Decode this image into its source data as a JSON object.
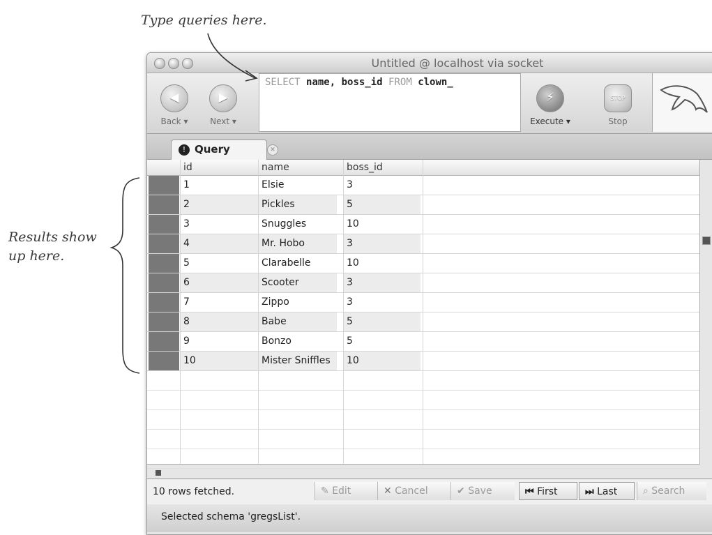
{
  "annotations": {
    "type_queries": "Type queries here.",
    "results_show": "Results show up here."
  },
  "window": {
    "title": "Untitled @ localhost via socket"
  },
  "toolbar": {
    "back_label": "Back ▾",
    "next_label": "Next ▾",
    "execute_label": "Execute ▾",
    "stop_label": "Stop",
    "stop_glyph": "STOP"
  },
  "query": {
    "select_kw": "SELECT",
    "fields": "name, boss_id",
    "from_kw": "FROM",
    "table": "clown_"
  },
  "tabs": [
    {
      "label": "Query",
      "icon": "info-icon"
    }
  ],
  "results": {
    "columns": [
      "id",
      "name",
      "boss_id"
    ],
    "rows": [
      [
        "1",
        "Elsie",
        "3"
      ],
      [
        "2",
        "Pickles",
        "5"
      ],
      [
        "3",
        "Snuggles",
        "10"
      ],
      [
        "4",
        "Mr. Hobo",
        "3"
      ],
      [
        "5",
        "Clarabelle",
        "10"
      ],
      [
        "6",
        "Scooter",
        "3"
      ],
      [
        "7",
        "Zippo",
        "3"
      ],
      [
        "8",
        "Babe",
        "5"
      ],
      [
        "9",
        "Bonzo",
        "5"
      ],
      [
        "10",
        "Mister Sniffles",
        "10"
      ]
    ]
  },
  "status": {
    "rows_fetched": "10 rows fetched.",
    "edit": "Edit",
    "cancel": "Cancel",
    "save": "Save",
    "first": "First",
    "last": "Last",
    "search": "Search",
    "schema": "Selected schema 'gregsList'."
  },
  "colors": {
    "selection_gutter": "#787878",
    "alt_row": "#ececec"
  }
}
